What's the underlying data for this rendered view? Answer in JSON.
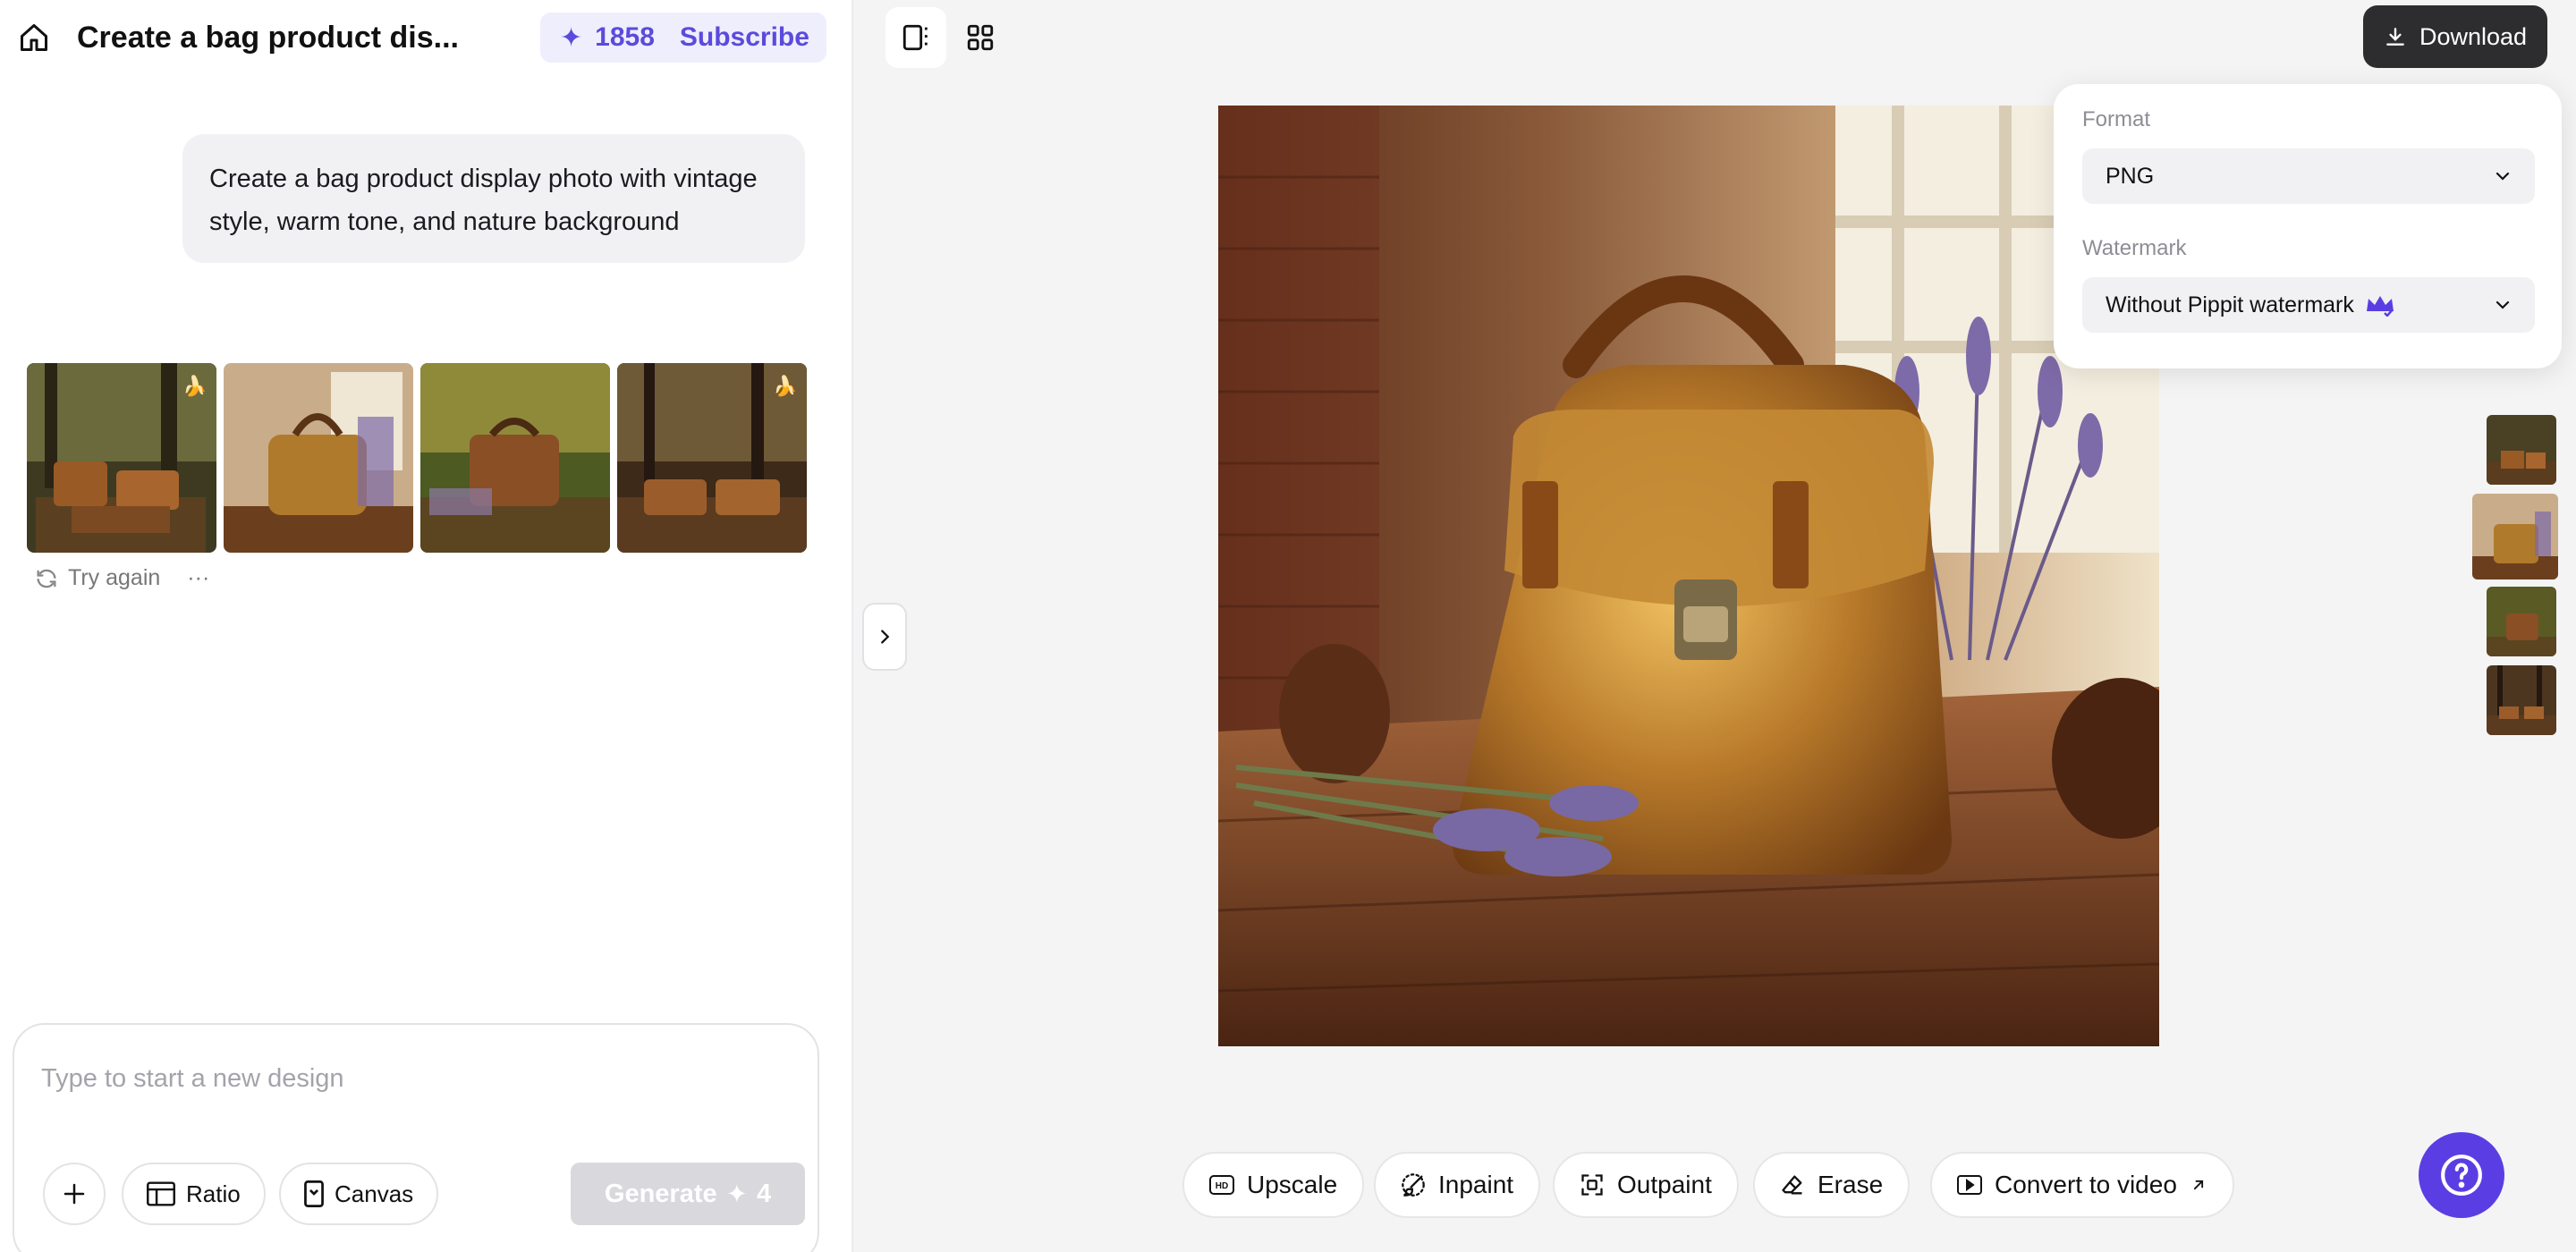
{
  "header": {
    "title": "Create a bag product dis...",
    "credits": "1858",
    "subscribe": "Subscribe"
  },
  "chat": {
    "prompt": "Create a bag product display photo with vintage style, warm tone, and nature background"
  },
  "thumbnails": [
    {
      "label": "forest-bags",
      "badge": "🍌"
    },
    {
      "label": "bag-lavender",
      "badge": ""
    },
    {
      "label": "bag-meadow",
      "badge": ""
    },
    {
      "label": "bags-forest-path",
      "badge": "🍌"
    }
  ],
  "actions": {
    "try_again": "Try again",
    "more": "···"
  },
  "composer": {
    "placeholder": "Type to start a new design",
    "ratio": "Ratio",
    "canvas": "Canvas",
    "generate": "Generate",
    "generate_cost": "4"
  },
  "download": {
    "button": "Download",
    "format_label": "Format",
    "format_value": "PNG",
    "watermark_label": "Watermark",
    "watermark_value": "Without Pippit watermark"
  },
  "toolbar": {
    "upscale": "Upscale",
    "inpaint": "Inpaint",
    "outpaint": "Outpaint",
    "erase": "Erase",
    "convert": "Convert to video"
  },
  "colors": {
    "accent": "#5a3ee3",
    "credits_bg": "#efeefd",
    "download_bg": "#2d2d30"
  }
}
